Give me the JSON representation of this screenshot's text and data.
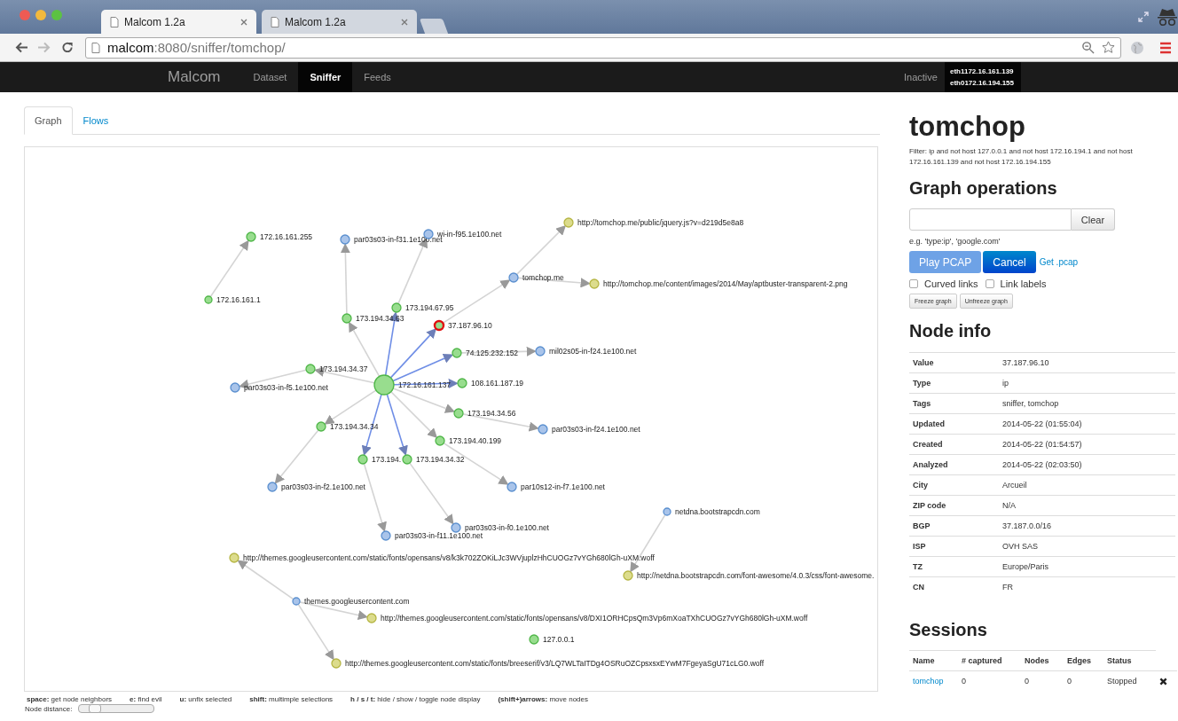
{
  "browser": {
    "tabs": [
      {
        "title": "Malcom 1.2a",
        "selected": true
      },
      {
        "title": "Malcom 1.2a",
        "selected": false
      }
    ],
    "url": {
      "host": "malcom",
      "path": ":8080/sniffer/tomchop/"
    }
  },
  "navbar": {
    "brand": "Malcom",
    "items": [
      {
        "label": "Dataset",
        "selected": false
      },
      {
        "label": "Sniffer",
        "selected": true
      },
      {
        "label": "Feeds",
        "selected": false
      }
    ],
    "status": "Inactive",
    "interfaces": [
      "eth1172.16.161.139",
      "eth0172.16.194.155"
    ]
  },
  "main_tabs": [
    {
      "label": "Graph",
      "selected": true
    },
    {
      "label": "Flows",
      "selected": false
    }
  ],
  "graph": {
    "nodes": [
      {
        "label": "http://tomchop.me/public/jquery.js?v=d219d5e8a8",
        "kind": "url",
        "selected": false,
        "link_selected": false
      },
      {
        "label": "172.16.161.255",
        "kind": "ip",
        "selected": false,
        "link_selected": false
      },
      {
        "label": "par03s03-in-f31.1e100.net",
        "kind": "host",
        "selected": false,
        "link_selected": false
      },
      {
        "label": "wi-in-f95.1e100.net",
        "kind": "host",
        "selected": false,
        "link_selected": false
      },
      {
        "label": "tomchop.me",
        "kind": "host",
        "selected": false,
        "link_selected": false
      },
      {
        "label": "http://tomchop.me/content/images/2014/May/aptbuster-transparent-2.png",
        "kind": "url",
        "selected": false,
        "link_selected": false
      },
      {
        "label": "172.16.161.1",
        "kind": "ip",
        "selected": false
      },
      {
        "label": "173.194.67.95",
        "kind": "ip",
        "selected": false,
        "link_selected": true
      },
      {
        "label": "173.194.34.63",
        "kind": "ip",
        "selected": false,
        "link_selected": false
      },
      {
        "label": "37.187.96.10",
        "kind": "ip",
        "selected": true,
        "link_selected": true
      },
      {
        "label": "74.125.232.152",
        "kind": "ip",
        "selected": false,
        "link_selected": true
      },
      {
        "label": "mil02s05-in-f24.1e100.net",
        "kind": "host",
        "selected": false,
        "link_selected": false
      },
      {
        "label": "173.194.34.37",
        "kind": "ip",
        "selected": false,
        "link_selected": false
      },
      {
        "label": "par03s03-in-f5.1e100.net",
        "kind": "host",
        "selected": false,
        "link_selected": false
      },
      {
        "label": "172.16.161.137",
        "kind": "ip",
        "selected": false
      },
      {
        "label": "108.161.187.19",
        "kind": "ip",
        "selected": false,
        "link_selected": true
      },
      {
        "label": "173.194.34.56",
        "kind": "ip",
        "selected": false,
        "link_selected": false
      },
      {
        "label": "173.194.34.34",
        "kind": "ip",
        "selected": false,
        "link_selected": false
      },
      {
        "label": "par03s03-in-f24.1e100.net",
        "kind": "host",
        "selected": false,
        "link_selected": false
      },
      {
        "label": "173.194.40.199",
        "kind": "ip",
        "selected": false,
        "link_selected": false
      },
      {
        "label": "173.194.",
        "kind": "ip",
        "selected": false,
        "link_selected": true
      },
      {
        "label": "173.194.34.32",
        "kind": "ip",
        "selected": false,
        "link_selected": true
      },
      {
        "label": "par03s03-in-f2.1e100.net",
        "kind": "host",
        "selected": false,
        "link_selected": false
      },
      {
        "label": "par10s12-in-f7.1e100.net",
        "kind": "host",
        "selected": false,
        "link_selected": false
      },
      {
        "label": "netdna.bootstrapcdn.com",
        "kind": "host",
        "selected": false
      },
      {
        "label": "par03s03-in-f0.1e100.net",
        "kind": "host",
        "selected": false,
        "link_selected": false
      },
      {
        "label": "par03s03-in-f11.1e100.net",
        "kind": "host",
        "selected": false,
        "link_selected": false
      },
      {
        "label": "http://themes.googleusercontent.com/static/fonts/opensans/v8/k3k702ZOKiLJc3WVjuplzHhCUOGz7vYGh680lGh-uXM.woff",
        "kind": "url",
        "selected": false,
        "link_selected": false
      },
      {
        "label": "http://netdna.bootstrapcdn.com/font-awesome/4.0.3/css/font-awesome.",
        "kind": "url",
        "selected": false,
        "link_selected": false
      },
      {
        "label": "themes.googleusercontent.com",
        "kind": "host",
        "selected": false
      },
      {
        "label": "http://themes.googleusercontent.com/static/fonts/opensans/v8/DXI1ORHCpsQm3Vp6mXoaTXhCUOGz7vYGh680lGh-uXM.woff",
        "kind": "url",
        "selected": false,
        "link_selected": false
      },
      {
        "label": "127.0.0.1",
        "kind": "ip",
        "selected": false
      },
      {
        "label": "http://themes.googleusercontent.com/static/fonts/breeserif/v3/LQ7WLTaITDg4OSRuOZCpsxsxEYwM7FgeyaSgU71cLG0.woff",
        "kind": "url",
        "selected": false,
        "link_selected": false
      }
    ]
  },
  "shortcuts": [
    {
      "key": "space:",
      "text": "get node neighbors"
    },
    {
      "key": "e:",
      "text": "find evil"
    },
    {
      "key": "u:",
      "text": "unfix selected"
    },
    {
      "key": "shift:",
      "text": "multimple selections"
    },
    {
      "key": "h / s / t:",
      "text": "hide / show / toggle node display"
    },
    {
      "key": "(shift+)arrows:",
      "text": "move nodes"
    }
  ],
  "node_distance": {
    "label": "Node distance:",
    "level": 0.15
  },
  "sidebar": {
    "title": "tomchop",
    "filter": "Filter: ip and not host 127.0.0.1 and not host 172.16.194.1 and not host 172.16.161.139 and not host 172.16.194.155",
    "graph_heading": "Graph operations",
    "clear_button": "Clear",
    "hint": "e.g. 'type:ip', 'google.com'",
    "buttons": [
      {
        "label": "Play PCAP",
        "kind": "light",
        "disabled": true
      },
      {
        "label": "Cancel",
        "kind": "primary",
        "disabled": false
      }
    ],
    "get_link": "Get .pcap",
    "checkboxes": [
      {
        "label": "Curved links",
        "checked": false
      },
      {
        "label": "Link labels",
        "checked": false
      }
    ],
    "small_buttons": [
      "Freeze graph",
      "Unfreeze graph"
    ],
    "node_heading": "Node info",
    "node_info": [
      {
        "label": "Value",
        "value": "37.187.96.10"
      },
      {
        "label": "Type",
        "value": "ip"
      },
      {
        "label": "Tags",
        "value": "sniffer, tomchop"
      },
      {
        "label": "Updated",
        "value": "2014-05-22 (01:55:04)"
      },
      {
        "label": "Created",
        "value": "2014-05-22 (01:54:57)"
      },
      {
        "label": "Analyzed",
        "value": "2014-05-22 (02:03:50)"
      },
      {
        "label": "City",
        "value": "Arcueil"
      },
      {
        "label": "ZIP code",
        "value": "N/A"
      },
      {
        "label": "BGP",
        "value": "37.187.0.0/16"
      },
      {
        "label": "ISP",
        "value": "OVH SAS"
      },
      {
        "label": "TZ",
        "value": "Europe/Paris"
      },
      {
        "label": "CN",
        "value": "FR"
      }
    ],
    "sessions_heading": "Sessions",
    "sessions_columns": [
      "Name",
      "# captured",
      "Nodes",
      "Edges",
      "Status"
    ],
    "sessions": [
      {
        "name": "tomchop",
        "captured": "0",
        "nodes": "0",
        "edges": "0",
        "status": "Stopped"
      }
    ]
  }
}
